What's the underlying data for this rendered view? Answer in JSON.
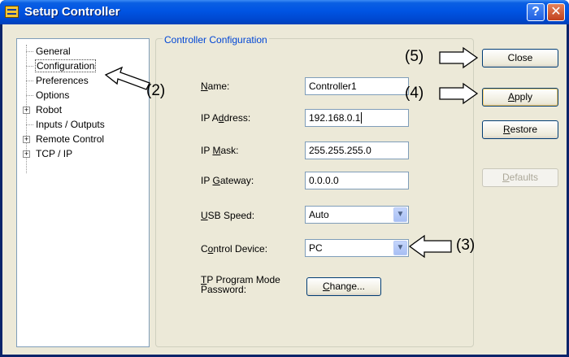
{
  "window": {
    "title": "Setup Controller"
  },
  "tree": {
    "items": [
      {
        "label": "General",
        "expandable": false
      },
      {
        "label": "Configuration",
        "expandable": false,
        "selected": true
      },
      {
        "label": "Preferences",
        "expandable": false
      },
      {
        "label": "Options",
        "expandable": false
      },
      {
        "label": "Robot",
        "expandable": true
      },
      {
        "label": "Inputs / Outputs",
        "expandable": false
      },
      {
        "label": "Remote Control",
        "expandable": true
      },
      {
        "label": "TCP / IP",
        "expandable": true
      }
    ]
  },
  "config": {
    "group_title": "Controller Configuration",
    "name": {
      "label_pre": "",
      "label_u": "N",
      "label_post": "ame:",
      "value": "Controller1"
    },
    "ip_address": {
      "label_pre": "IP A",
      "label_u": "d",
      "label_post": "dress:",
      "value": "192.168.0.1"
    },
    "ip_mask": {
      "label_pre": "IP ",
      "label_u": "M",
      "label_post": "ask:",
      "value": "255.255.255.0"
    },
    "ip_gateway": {
      "label_pre": "IP ",
      "label_u": "G",
      "label_post": "ateway:",
      "value": "0.0.0.0"
    },
    "usb_speed": {
      "label_pre": "",
      "label_u": "U",
      "label_post": "SB Speed:",
      "value": "Auto"
    },
    "control_device": {
      "label_pre": "C",
      "label_u": "o",
      "label_post": "ntrol Device:",
      "value": "PC"
    },
    "tp_password": {
      "label_line1_u": "T",
      "label_line1_post": "P Program Mode",
      "label_line2": "Password:",
      "button_u": "C",
      "button_post": "hange..."
    }
  },
  "buttons": {
    "close": "Close",
    "apply_u": "A",
    "apply_post": "pply",
    "restore_u": "R",
    "restore_post": "estore",
    "defaults_u": "D",
    "defaults_post": "efaults"
  },
  "annotations": {
    "a2": "(2)",
    "a3": "(3)",
    "a4": "(4)",
    "a5": "(5)"
  },
  "icons": {
    "help": "?",
    "close": "✕",
    "combo": "▼",
    "expand": "+"
  },
  "colors": {
    "titlebar": "#0054e3",
    "dialog_bg": "#ece9d8",
    "group_title": "#0046d5"
  }
}
